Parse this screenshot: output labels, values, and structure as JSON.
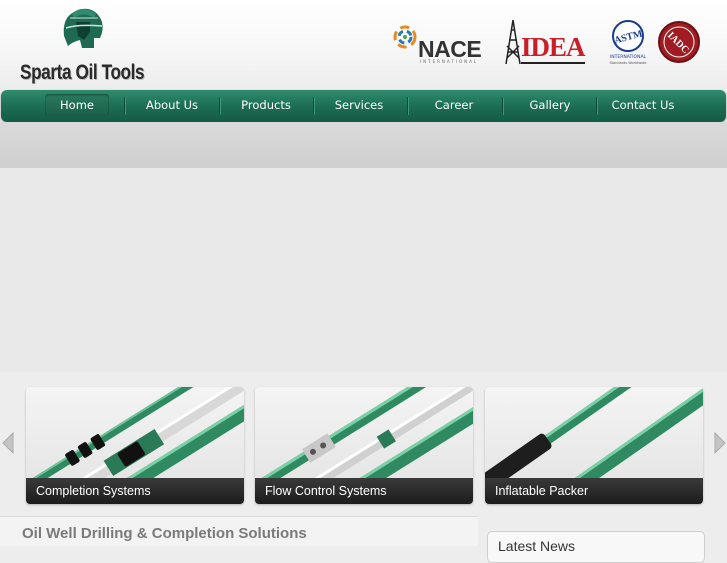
{
  "brand": {
    "name": "Sparta Oil Tools",
    "logo_icon": "spartan-helmet-icon"
  },
  "associations": {
    "nace": {
      "name": "NACE",
      "sub": "INTERNATIONAL"
    },
    "idea": {
      "name": "IDEA"
    },
    "astm": {
      "name": "ASTM",
      "sub": "INTERNATIONAL"
    },
    "iadc": {
      "name": "IADC"
    }
  },
  "nav": {
    "items": [
      {
        "label": "Home",
        "active": true
      },
      {
        "label": "About Us"
      },
      {
        "label": "Products"
      },
      {
        "label": "Services"
      },
      {
        "label": "Career"
      },
      {
        "label": "Gallery"
      },
      {
        "label": "Contact Us"
      }
    ]
  },
  "products": [
    {
      "label": "Completion Systems"
    },
    {
      "label": "Flow Control Systems"
    },
    {
      "label": "Inflatable Packer"
    }
  ],
  "carousel": {
    "prev_icon": "chevron-left-icon",
    "next_icon": "chevron-right-icon"
  },
  "bottom": {
    "heading": "Oil Well Drilling & Completion Solutions",
    "news_title": "Latest News"
  },
  "colors": {
    "nav": "#1d6e54",
    "accent": "#2a8a6a",
    "idea_red": "#c8202a"
  }
}
